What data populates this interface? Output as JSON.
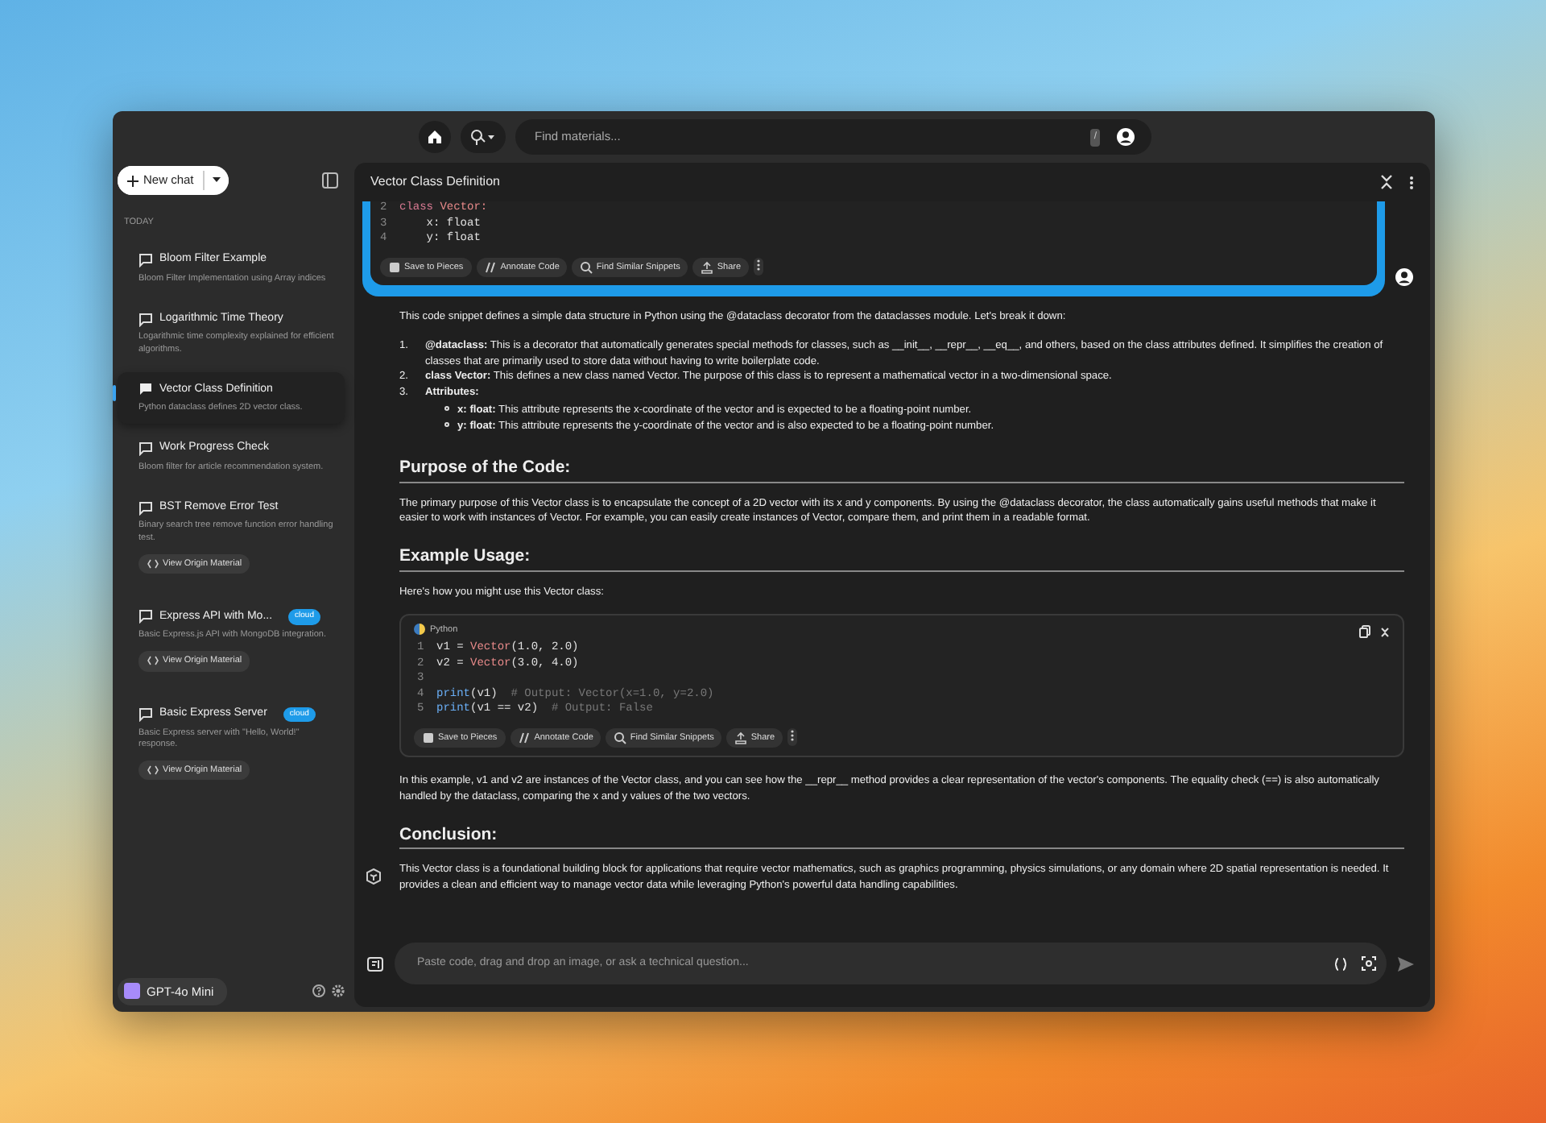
{
  "topbar": {
    "search": {
      "placeholder": "Find materials..."
    },
    "shortcut": "/"
  },
  "sidebar": {
    "new_chat": "New chat",
    "section": "TODAY",
    "chats": [
      {
        "title": "Bloom Filter Example",
        "subtitle": "Bloom Filter Implementation using Array indices",
        "selected": false
      },
      {
        "title": "Logarithmic Time Theory",
        "subtitle": "Logarithmic time complexity explained for efficient algorithms.",
        "selected": false
      },
      {
        "title": "Vector Class Definition",
        "subtitle": "Python dataclass defines 2D vector class.",
        "selected": true
      },
      {
        "title": "Work Progress Check",
        "subtitle": "Bloom filter for article recommendation system.",
        "selected": false
      },
      {
        "title": "BST Remove Error Test",
        "subtitle": "Binary search tree remove function error handling test.",
        "selected": false,
        "action": "View Origin Material"
      },
      {
        "title": "Express API with Mo...",
        "subtitle": "Basic Express.js API with MongoDB integration.",
        "selected": false,
        "badge": "cloud",
        "action": "View Origin Material"
      },
      {
        "title": "Basic Express Server",
        "subtitle": "Basic Express server with \"Hello, World!\" response.",
        "selected": false,
        "badge": "cloud",
        "action": "View Origin Material"
      }
    ],
    "model": "GPT-4o Mini"
  },
  "conversation": {
    "title": "Vector Class Definition",
    "user_snippet": {
      "lines": [
        {
          "n": "2",
          "tokens": [
            {
              "text": "class ",
              "kind": "keyword"
            },
            {
              "text": "Vector:",
              "kind": "class"
            }
          ]
        },
        {
          "n": "3",
          "tokens": [
            {
              "text": "    x: float",
              "kind": "plain"
            }
          ]
        },
        {
          "n": "4",
          "tokens": [
            {
              "text": "    y: float",
              "kind": "plain"
            }
          ]
        }
      ],
      "actions": [
        "Save to Pieces",
        "Annotate Code",
        "Find Similar Snippets",
        "Share"
      ]
    },
    "answer": [
      {
        "kind": "paragraph",
        "text": "This code snippet defines a simple data structure in Python using the @dataclass decorator from the dataclasses module. Let's break it down:"
      },
      {
        "kind": "list",
        "items": [
          {
            "n": "1.",
            "text": "**@dataclass:** This is a decorator that automatically generates special methods for classes, such as __init__, __repr__, __eq__, and others, based on the class attributes defined. It simplifies the creation of classes that are primarily used to store data without having to write boilerplate code."
          },
          {
            "n": "2.",
            "text": "**class Vector:** This defines a new class named Vector. The purpose of this class is to represent a mathematical vector in a two-dimensional space."
          },
          {
            "n": "3.",
            "text": "**Attributes:**",
            "children": [
              {
                "text": "**x: float:** This attribute represents the x-coordinate of the vector and is expected to be a floating-point number."
              },
              {
                "text": "**y: float:** This attribute represents the y-coordinate of the vector and is also expected to be a floating-point number."
              }
            ]
          }
        ]
      },
      {
        "kind": "heading",
        "text": "Purpose of the Code:"
      },
      {
        "kind": "paragraph",
        "text": "The primary purpose of this Vector class is to encapsulate the concept of a 2D vector with its x and y components. By using the @dataclass decorator, the class automatically gains useful methods that make it easier to work with instances of Vector. For example, you can easily create instances of Vector, compare them, and print them in a readable format."
      },
      {
        "kind": "heading",
        "text": "Example Usage:"
      },
      {
        "kind": "paragraph",
        "text": "Here's how you might use this Vector class:"
      },
      {
        "kind": "code",
        "language": "Python",
        "lines": [
          {
            "n": "1",
            "tokens": [
              {
                "text": "v1 = ",
                "kind": "plain"
              },
              {
                "text": "Vector",
                "kind": "class"
              },
              {
                "text": "(1.0, 2.0)",
                "kind": "plain"
              }
            ]
          },
          {
            "n": "2",
            "tokens": [
              {
                "text": "v2 = ",
                "kind": "plain"
              },
              {
                "text": "Vector",
                "kind": "class"
              },
              {
                "text": "(3.0, 4.0)",
                "kind": "plain"
              }
            ]
          },
          {
            "n": "3"
          },
          {
            "n": "4",
            "tokens": [
              {
                "text": "print",
                "kind": "func"
              },
              {
                "text": "(v1)  ",
                "kind": "plain"
              },
              {
                "text": "# Output: Vector(x=1.0, y=2.0)",
                "kind": "comment"
              }
            ]
          },
          {
            "n": "5",
            "tokens": [
              {
                "text": "print",
                "kind": "func"
              },
              {
                "text": "(v1 == v2)  ",
                "kind": "plain"
              },
              {
                "text": "# Output: False",
                "kind": "comment"
              }
            ]
          }
        ],
        "actions": [
          "Save to Pieces",
          "Annotate Code",
          "Find Similar Snippets",
          "Share"
        ]
      },
      {
        "kind": "paragraph",
        "text": "In this example, v1 and v2 are instances of the Vector class, and you can see how the __repr__ method provides a clear representation of the vector's components. The equality check (==) is also automatically handled by the dataclass, comparing the x and y values of the two vectors."
      },
      {
        "kind": "heading",
        "text": "Conclusion:"
      },
      {
        "kind": "paragraph",
        "text": "This Vector class is a foundational building block for applications that require vector mathematics, such as graphics programming, physics simulations, or any domain where 2D spatial representation is needed. It provides a clean and efficient way to manage vector data while leveraging Python's powerful data handling capabilities.",
        "with_logo": true
      }
    ]
  },
  "composer": {
    "placeholder": "Paste code, drag and drop an image, or ask a technical question..."
  }
}
